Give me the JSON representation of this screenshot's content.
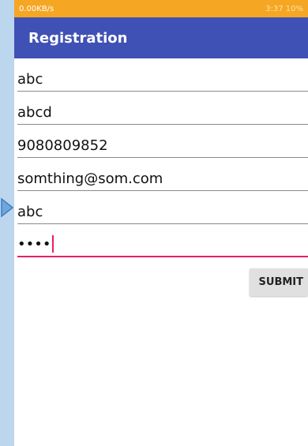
{
  "status_bar": {
    "left": "0.00KB/s",
    "time": "3:37",
    "battery": "10%"
  },
  "app_bar": {
    "title": "Registration"
  },
  "fields": [
    {
      "name": "field-1",
      "value": "abc"
    },
    {
      "name": "field-2",
      "value": "abcd"
    },
    {
      "name": "phone-field",
      "value": "9080809852"
    },
    {
      "name": "email-field",
      "value": "somthing@som.com"
    },
    {
      "name": "field-5",
      "value": "abc"
    },
    {
      "name": "password-field",
      "value": "••••"
    }
  ],
  "submit_label": "SUBMIT",
  "colors": {
    "app_bar": "#3f51b5",
    "accent": "#e91e63",
    "status_bar": "#f5a623"
  }
}
